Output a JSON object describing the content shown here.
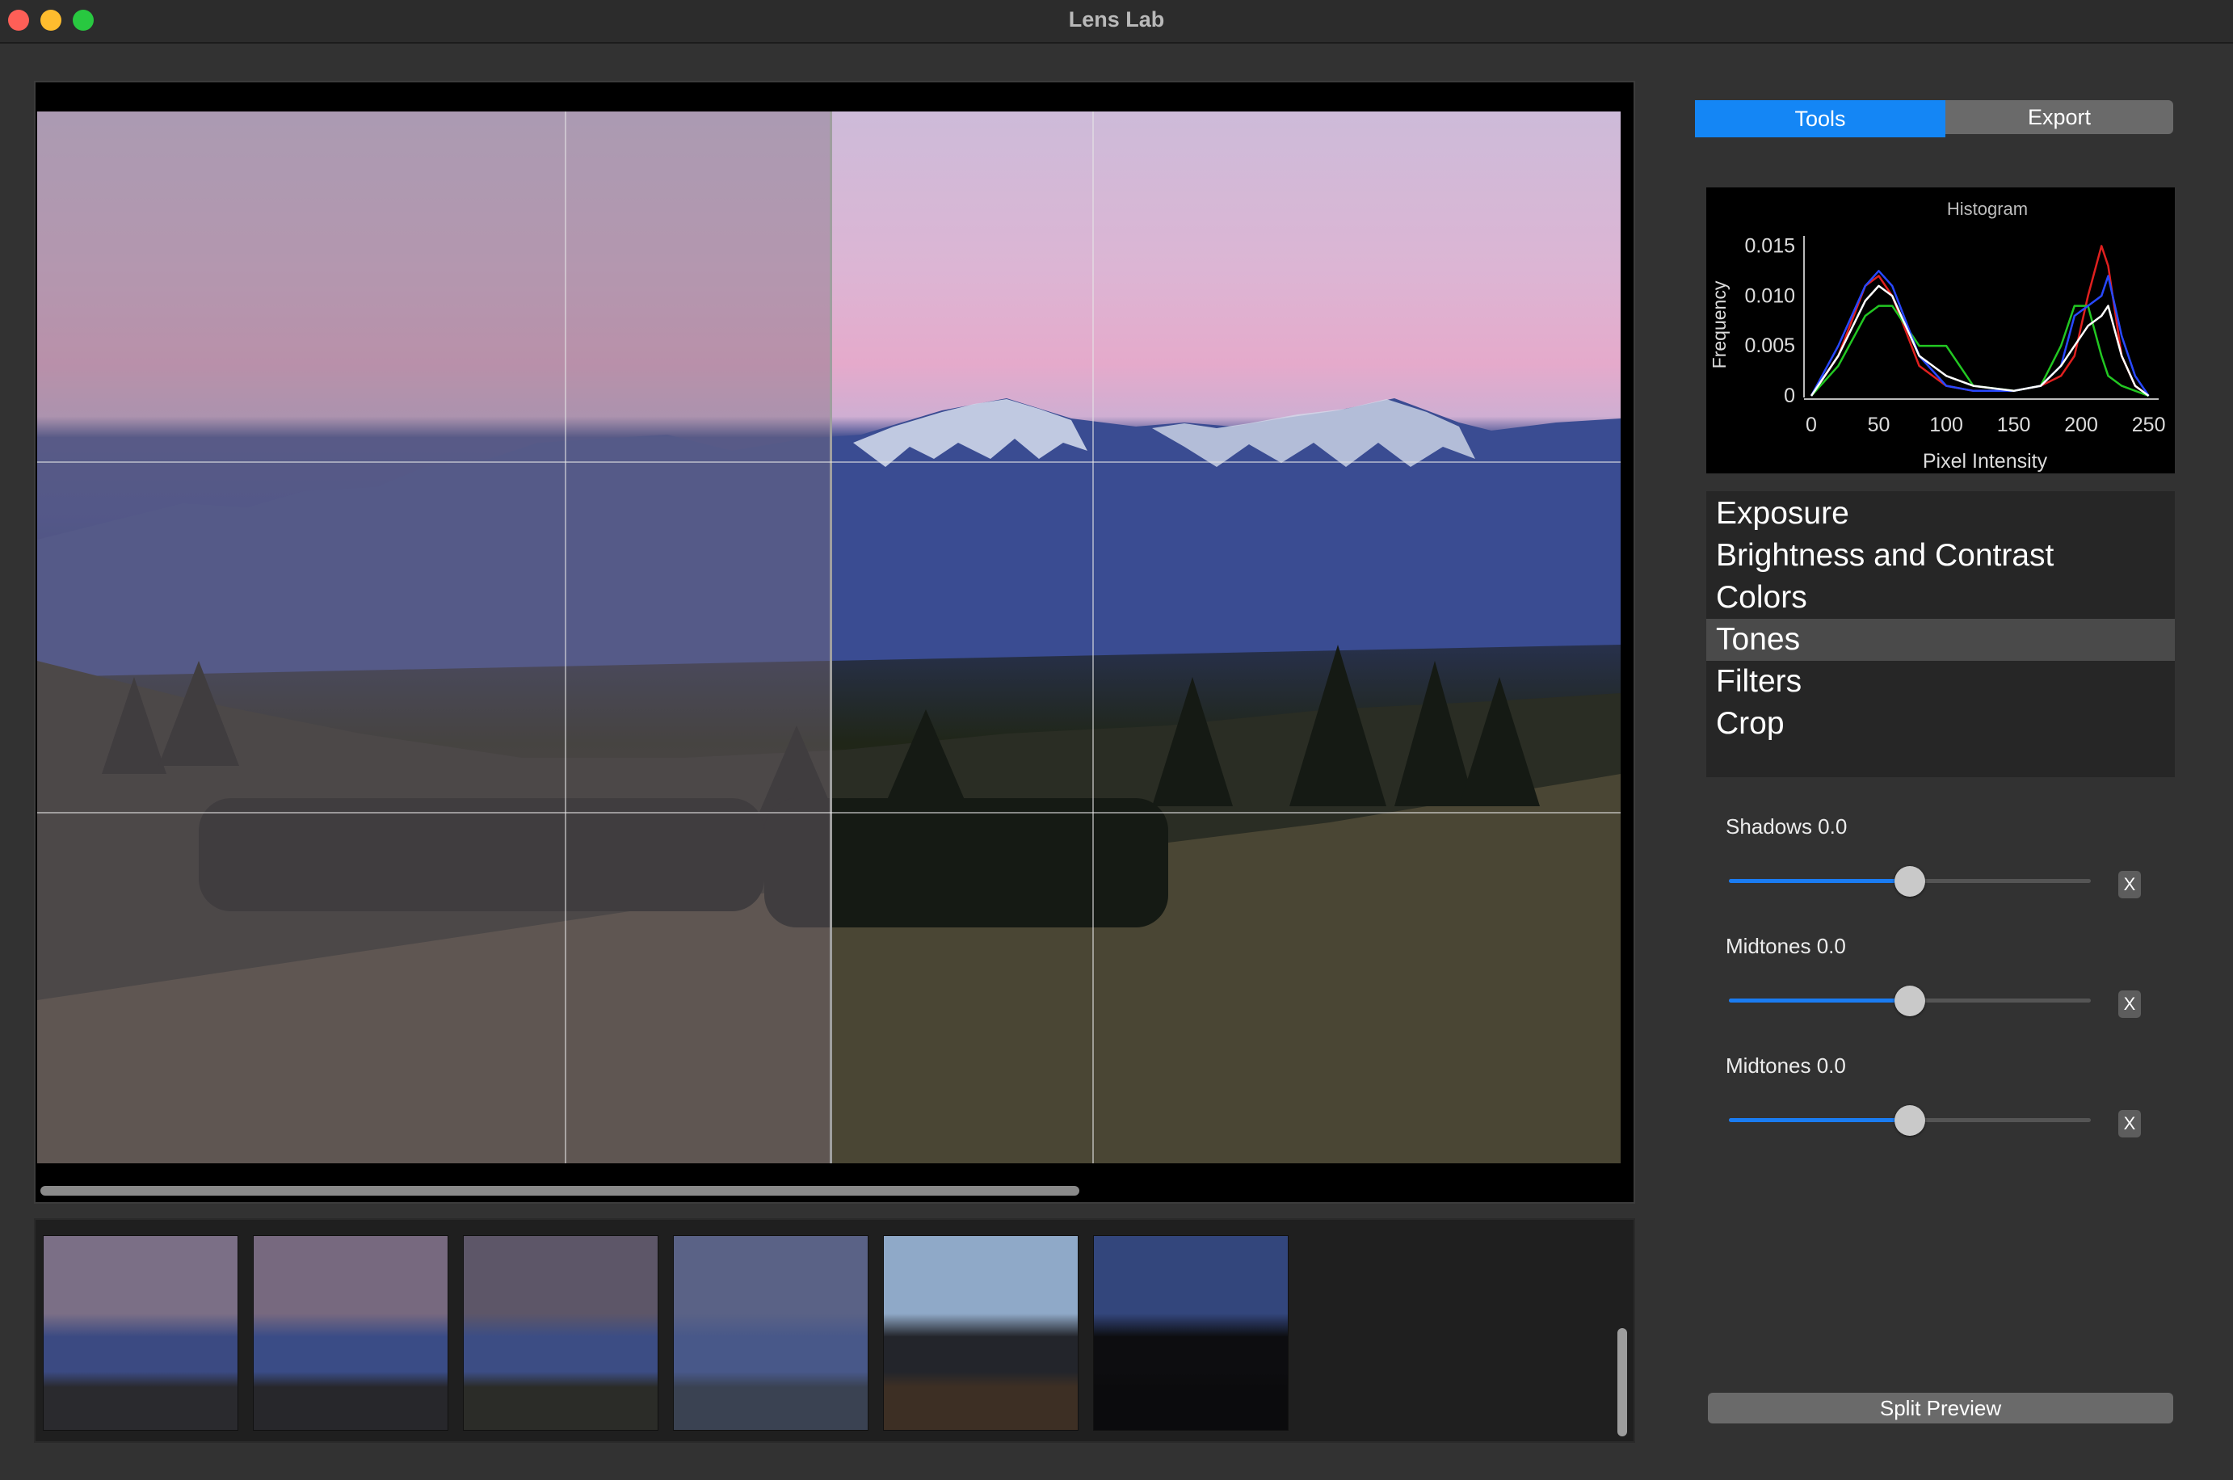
{
  "window": {
    "title": "Lens Lab"
  },
  "tabs": [
    {
      "label": "Tools",
      "selected": true
    },
    {
      "label": "Export",
      "selected": false
    }
  ],
  "histogram": {
    "title": "Histogram",
    "xlabel": "Pixel Intensity",
    "ylabel": "Frequency",
    "x_ticks": [
      "0",
      "50",
      "100",
      "150",
      "200",
      "250"
    ],
    "y_ticks": [
      "0",
      "0.005",
      "0.010",
      "0.015"
    ],
    "colors": {
      "red": "#e0201f",
      "green": "#22c722",
      "blue": "#2848ff",
      "luma": "#ffffff"
    }
  },
  "chart_data": {
    "type": "line",
    "title": "Histogram",
    "xlabel": "Pixel Intensity",
    "ylabel": "Frequency",
    "xlim": [
      0,
      255
    ],
    "ylim": [
      0,
      0.016
    ],
    "x": [
      0,
      20,
      40,
      50,
      60,
      80,
      100,
      120,
      150,
      170,
      185,
      195,
      205,
      215,
      220,
      230,
      240,
      250
    ],
    "series": [
      {
        "name": "red",
        "values": [
          0,
          0.004,
          0.011,
          0.012,
          0.01,
          0.003,
          0.001,
          0.0005,
          0.0005,
          0.001,
          0.002,
          0.004,
          0.01,
          0.015,
          0.013,
          0.004,
          0.001,
          0
        ]
      },
      {
        "name": "green",
        "values": [
          0,
          0.003,
          0.008,
          0.009,
          0.009,
          0.005,
          0.005,
          0.001,
          0.0005,
          0.001,
          0.005,
          0.009,
          0.009,
          0.004,
          0.002,
          0.001,
          0.0005,
          0
        ]
      },
      {
        "name": "blue",
        "values": [
          0,
          0.005,
          0.011,
          0.0125,
          0.011,
          0.004,
          0.001,
          0.0005,
          0.0005,
          0.001,
          0.003,
          0.008,
          0.009,
          0.01,
          0.012,
          0.006,
          0.002,
          0
        ]
      },
      {
        "name": "luma",
        "values": [
          0,
          0.004,
          0.0095,
          0.011,
          0.01,
          0.004,
          0.002,
          0.001,
          0.0005,
          0.001,
          0.003,
          0.005,
          0.007,
          0.008,
          0.009,
          0.004,
          0.001,
          0
        ]
      }
    ]
  },
  "tool_menu": {
    "items": [
      {
        "label": "Exposure",
        "selected": false
      },
      {
        "label": "Brightness and Contrast",
        "selected": false
      },
      {
        "label": "Colors",
        "selected": false
      },
      {
        "label": "Tones",
        "selected": true
      },
      {
        "label": "Filters",
        "selected": false
      },
      {
        "label": "Crop",
        "selected": false
      }
    ]
  },
  "sliders": [
    {
      "label": "Shadows 0.0",
      "value_fraction": 0.5,
      "reset_label": "X"
    },
    {
      "label": "Midtones 0.0",
      "value_fraction": 0.5,
      "reset_label": "X"
    },
    {
      "label": "Midtones 0.0",
      "value_fraction": 0.5,
      "reset_label": "X"
    }
  ],
  "split_preview": {
    "label": "Split Preview",
    "split_fraction": 0.5
  },
  "viewer": {
    "grid": "rule-of-thirds",
    "horizontal_scroll_fraction": 0.66
  },
  "filmstrip": {
    "thumbnails": [
      {
        "name": "thumbnail-1",
        "sky": "#7b6f86",
        "peak": "#3b4a82",
        "ground": "#2a2a2e"
      },
      {
        "name": "thumbnail-2",
        "sky": "#77697f",
        "peak": "#3a4c86",
        "ground": "#27272b"
      },
      {
        "name": "thumbnail-3",
        "sky": "#5d5668",
        "peak": "#3c4d84",
        "ground": "#2b2c28"
      },
      {
        "name": "thumbnail-4",
        "sky": "#5a6286",
        "peak": "#485889",
        "ground": "#3a4252"
      },
      {
        "name": "thumbnail-5",
        "sky": "#8fa9c8",
        "peak": "#23252b",
        "ground": "#3d2f24"
      },
      {
        "name": "thumbnail-6",
        "sky": "#33467c",
        "peak": "#0d0d10",
        "ground": "#0b0b0d"
      }
    ]
  }
}
